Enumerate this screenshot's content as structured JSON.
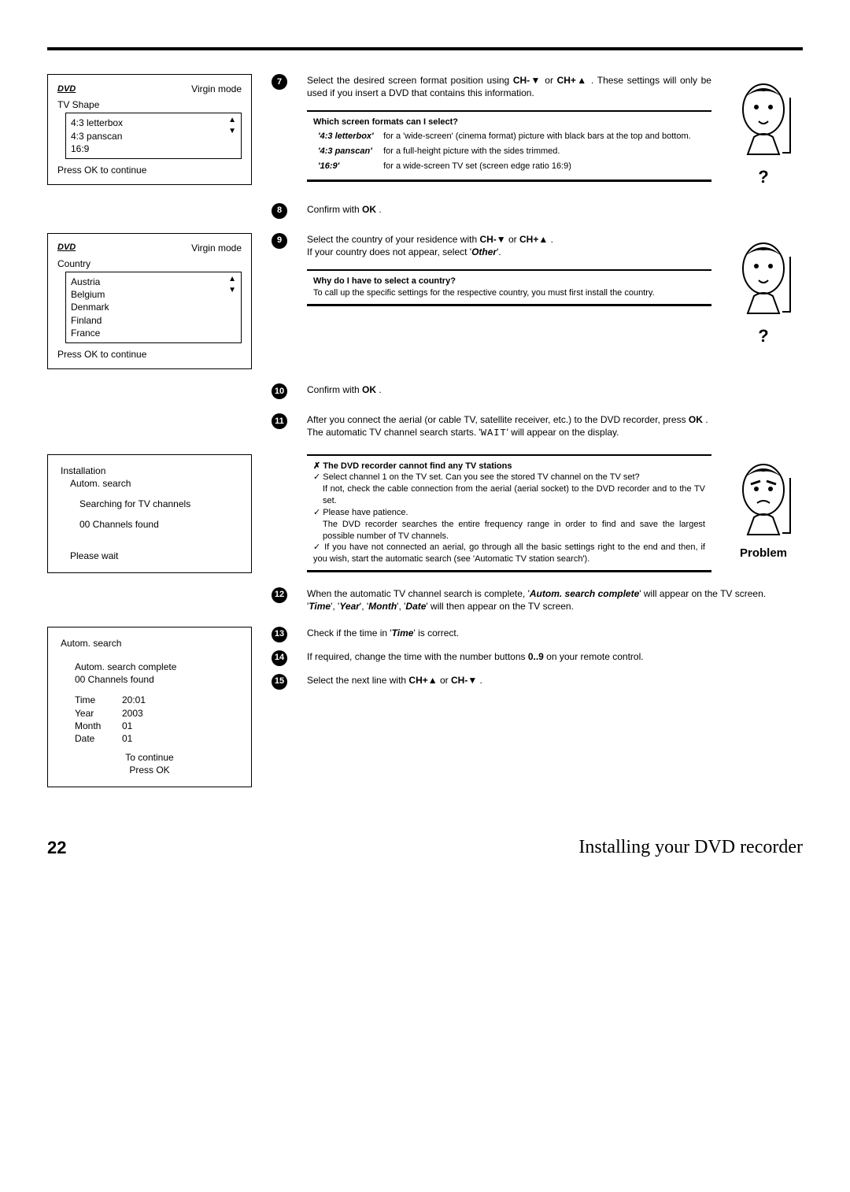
{
  "page": {
    "number": "22",
    "title": "Installing your DVD recorder"
  },
  "osd1": {
    "logo": "DVD",
    "mode": "Virgin mode",
    "title": "TV Shape",
    "items": [
      "4:3 letterbox",
      "4:3 panscan",
      "16:9"
    ],
    "foot": "Press OK to continue"
  },
  "osd2": {
    "logo": "DVD",
    "mode": "Virgin mode",
    "title": "Country",
    "items": [
      "Austria",
      "Belgium",
      "Denmark",
      "Finland",
      "France"
    ],
    "foot": "Press OK to continue"
  },
  "osd3": {
    "head": "Installation",
    "sub": "Autom. search",
    "line1": "Searching for TV channels",
    "line2": "00 Channels found",
    "line3": "Please wait"
  },
  "osd4": {
    "head": "Autom. search",
    "done": "Autom. search complete",
    "found": "00 Channels found",
    "rows": {
      "time": {
        "k": "Time",
        "v": "20:01"
      },
      "year": {
        "k": "Year",
        "v": "2003"
      },
      "month": {
        "k": "Month",
        "v": "01"
      },
      "date": {
        "k": "Date",
        "v": "01"
      }
    },
    "foot1": "To continue",
    "foot2": "Press OK"
  },
  "steps": {
    "s7": {
      "n": "7",
      "pre": "Select the desired screen format position using ",
      "btn1": "CH-",
      "g1": "▼",
      "mid": " or ",
      "btn2": "CH+",
      "g2": "▲",
      "post": " . These settings will only be used if you insert a DVD that contains this information."
    },
    "s8": {
      "n": "8",
      "pre": "Confirm with ",
      "btn1": "OK",
      "post": " ."
    },
    "s9": {
      "n": "9",
      "line1a": "Select the country of your residence with ",
      "btn1": "CH-",
      "g1": "▼",
      "mid": " or ",
      "btn2": "CH+",
      "g2": "▲",
      "line1b": " .",
      "line2a": "If your country does not appear, select '",
      "other": "Other",
      "line2b": "'."
    },
    "s10": {
      "n": "10",
      "pre": "Confirm with ",
      "btn1": "OK",
      "post": " ."
    },
    "s11": {
      "n": "11",
      "l1a": "After you connect the aerial (or cable TV, satellite receiver, etc.) to the DVD recorder, press ",
      "btn1": "OK",
      "l1b": " .",
      "l2a": "The automatic TV channel search starts. '",
      "wait": "WAIT",
      "l2b": "' will appear on the display."
    },
    "s12": {
      "n": "12",
      "l1a": "When the automatic TV channel search is complete, '",
      "b1": "Autom. search complete",
      "l1b": "' will appear on the TV screen.",
      "l2a": "'",
      "t": "Time",
      "sep": "', '",
      "y": "Year",
      "m": "Month",
      "d": "Date",
      "l2b": "' will then appear on the TV screen."
    },
    "s13": {
      "n": "13",
      "pre": "Check if the time in '",
      "t": "Time",
      "post": "' is correct."
    },
    "s14": {
      "n": "14",
      "pre": "If required, change the time with the number buttons ",
      "btn1": "0..9",
      "post": " on your remote control."
    },
    "s15": {
      "n": "15",
      "pre": "Select the next line with ",
      "btn1": "CH+",
      "g1": "▲",
      "mid": " or ",
      "btn2": "CH-",
      "g2": "▼",
      "post": " ."
    }
  },
  "tip1": {
    "title": "Which screen formats can I select?",
    "rows": {
      "r1": {
        "k": "4:3 letterbox",
        "v": "for a 'wide-screen' (cinema format) picture with black bars at the top and bottom."
      },
      "r2": {
        "k": "4:3 panscan",
        "v": "for a full-height picture with the sides trimmed."
      },
      "r3": {
        "k": "16:9",
        "v": "for a wide-screen TV set (screen edge ratio 16:9)"
      }
    }
  },
  "tip2": {
    "title": "Why do I have to select a country?",
    "body": "To call up the specific settings for the respective country, you must first install the country."
  },
  "tip3": {
    "title": "The DVD recorder cannot find any TV stations",
    "c1a": "Select channel 1 on the TV set. Can you see the stored TV channel on the TV set?",
    "c1b": "If not, check the cable connection from the aerial (aerial socket) to the DVD recorder and to the TV set.",
    "c2a": "Please have patience.",
    "c2b": "The DVD recorder searches the entire frequency range in order to find and save the largest possible number of TV channels.",
    "c3": "If you have not connected an aerial, go through all the basic settings right to the end and then, if you wish, start the automatic search (see 'Automatic TV station search')."
  },
  "labels": {
    "q": "?",
    "problem": "Problem"
  }
}
